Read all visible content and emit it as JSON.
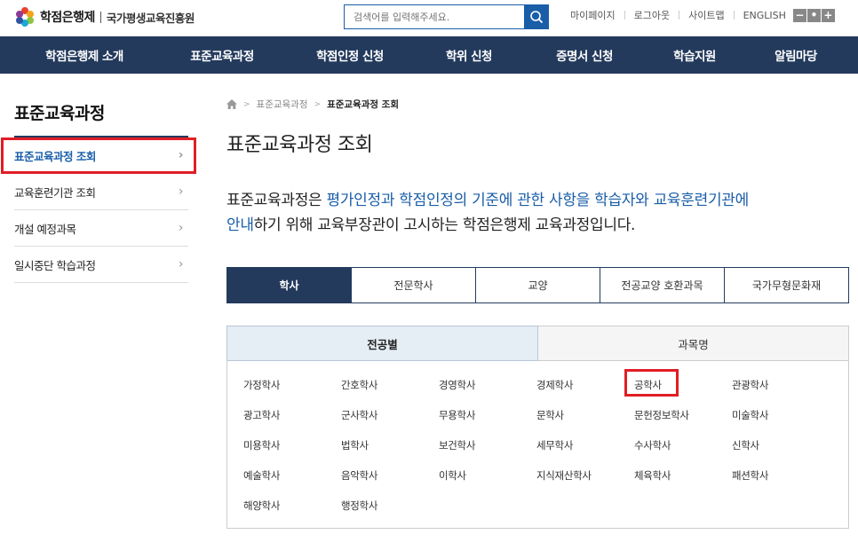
{
  "header": {
    "logo_text": "학점은행제",
    "org_name": "국가평생교육진흥원",
    "search": {
      "placeholder": "검색어를 입력해주세요."
    },
    "util_links": [
      "마이페이지",
      "로그아웃",
      "사이트맵",
      "ENGLISH"
    ],
    "zoom_buttons": [
      "−",
      "•",
      "+"
    ]
  },
  "gnb": [
    "학점은행제 소개",
    "표준교육과정",
    "학점인정 신청",
    "학위 신청",
    "증명서 신청",
    "학습지원",
    "알림마당"
  ],
  "sidebar": {
    "title": "표준교육과정",
    "items": [
      {
        "label": "표준교육과정 조회"
      },
      {
        "label": "교육훈련기관 조회"
      },
      {
        "label": "개설 예정과목"
      },
      {
        "label": "일시중단 학습과정"
      }
    ]
  },
  "breadcrumb": [
    "표준교육과정",
    "표준교육과정 조회"
  ],
  "main": {
    "page_title": "표준교육과정 조회",
    "intro": {
      "p1": "표준교육과정은 ",
      "p2": "평가인정과 학점인정의 기준에 관한 사항을 학습자와 교육훈련기관에",
      "p3": "안내",
      "p4": "하기 위해 교육부장관이 고시하는 학점은행제 교육과정입니다."
    },
    "tabs": [
      "학사",
      "전문학사",
      "교양",
      "전공교양 호환과목",
      "국가무형문화재"
    ],
    "subtabs": [
      "전공별",
      "과목명"
    ],
    "degrees": [
      "가정학사",
      "간호학사",
      "경영학사",
      "경제학사",
      "공학사",
      "관광학사",
      "광고학사",
      "군사학사",
      "무용학사",
      "문학사",
      "문헌정보학사",
      "미술학사",
      "미용학사",
      "법학사",
      "보건학사",
      "세무학사",
      "수사학사",
      "신학사",
      "예술학사",
      "음악학사",
      "이학사",
      "지식재산학사",
      "체육학사",
      "패션학사",
      "해양학사",
      "행정학사"
    ]
  },
  "colors": {
    "navy": "#233a5c",
    "blue": "#1a5ea8",
    "highlight_red": "#e01e25"
  }
}
